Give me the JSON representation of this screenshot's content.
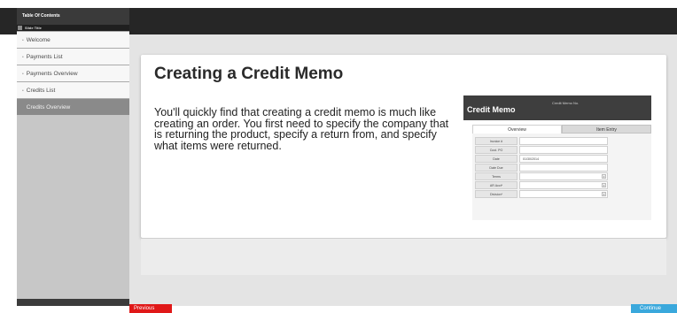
{
  "sidebar": {
    "header": "Table Of Contents",
    "slide_title_label": "Slide Title",
    "items": [
      {
        "label": "Welcome"
      },
      {
        "label": "Payments List"
      },
      {
        "label": "Payments Overview"
      },
      {
        "label": "Credits List"
      },
      {
        "label": "Credits Overview",
        "active": true
      }
    ]
  },
  "slide": {
    "heading": "Creating a Credit Memo",
    "body": "You'll quickly find that creating a credit memo is much like creating an order. You first need to specify the company that is returning the product, specify a return from, and specify what items were returned."
  },
  "memo": {
    "title": "Credit Memo",
    "number_label": "Credit Memo No.",
    "tabs": [
      "Overview",
      "Item Entry"
    ],
    "fields": [
      {
        "label": "Invoice #",
        "value": ""
      },
      {
        "label": "Cust. PO",
        "value": ""
      },
      {
        "label": "Date",
        "value": "01/30/2014"
      },
      {
        "label": "Date Due",
        "value": ""
      },
      {
        "label": "Terms",
        "value": "",
        "dropdown": true
      },
      {
        "label": "AR Acct*",
        "value": "",
        "dropdown": true
      },
      {
        "label": "Division*",
        "value": "",
        "dropdown": true
      }
    ]
  },
  "nav": {
    "previous_label": "Previous",
    "continue_label": "Continue"
  },
  "colors": {
    "previous": "#e01818",
    "continue": "#3aa8dc",
    "sidebar_active": "#8a8a8a",
    "topbar": "#262626"
  }
}
